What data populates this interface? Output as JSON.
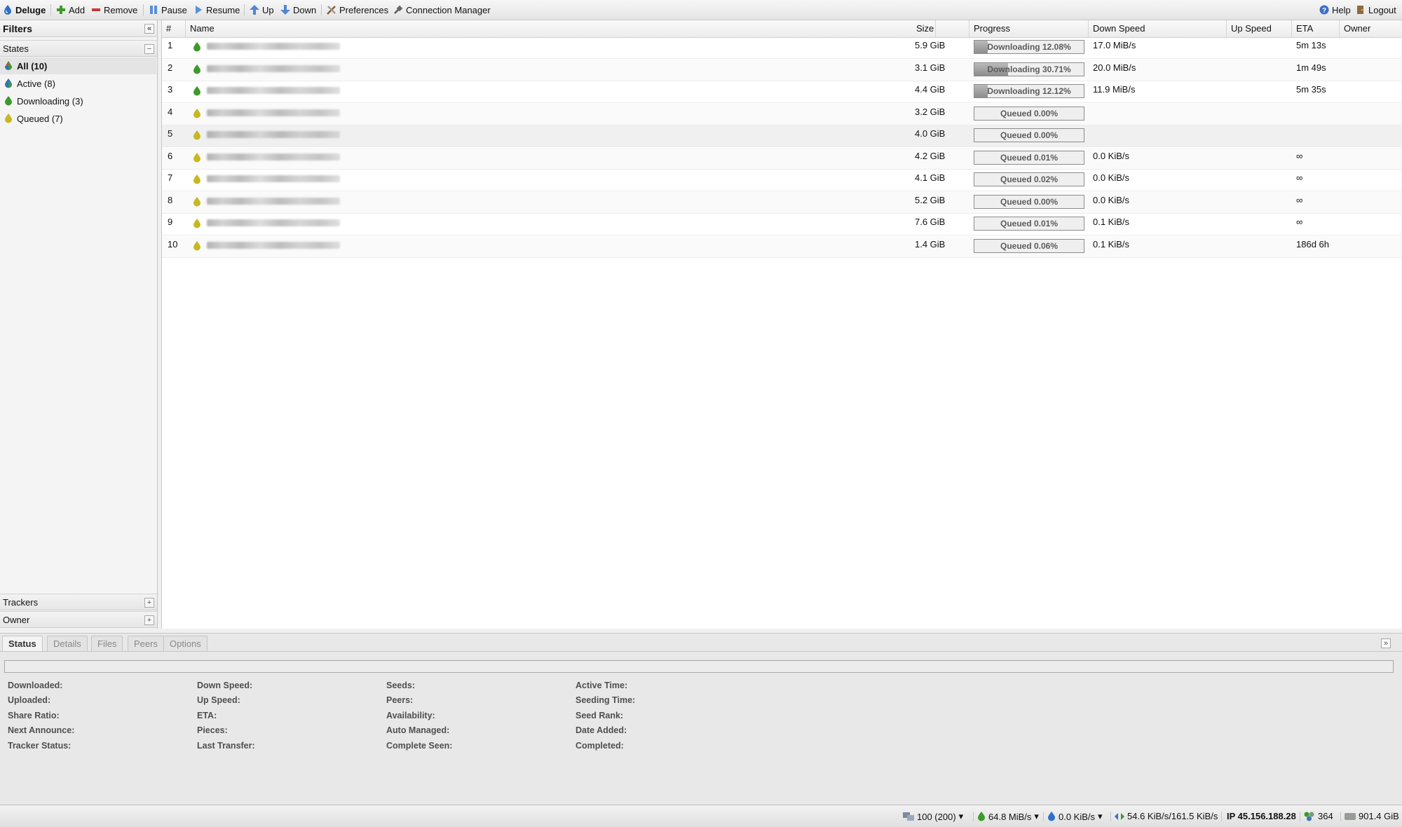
{
  "toolbar": {
    "app_name": "Deluge",
    "add": "Add",
    "remove": "Remove",
    "pause": "Pause",
    "resume": "Resume",
    "up": "Up",
    "down": "Down",
    "preferences": "Preferences",
    "connection_manager": "Connection Manager",
    "help": "Help",
    "logout": "Logout"
  },
  "sidebar": {
    "title": "Filters",
    "states_title": "States",
    "states": [
      {
        "label": "All (10)",
        "selected": true,
        "icon": "all-states-icon"
      },
      {
        "label": "Active (8)",
        "selected": false,
        "icon": "active-state-icon"
      },
      {
        "label": "Downloading (3)",
        "selected": false,
        "icon": "downloading-state-icon"
      },
      {
        "label": "Queued (7)",
        "selected": false,
        "icon": "queued-state-icon"
      }
    ],
    "trackers_title": "Trackers",
    "owner_title": "Owner"
  },
  "grid": {
    "columns": [
      "#",
      "Name",
      "Size",
      "Progress",
      "Down Speed",
      "Up Speed",
      "ETA",
      "Owner"
    ],
    "rows": [
      {
        "num": "1",
        "size": "5.9 GiB",
        "progress_text": "Downloading 12.08%",
        "progress": 0.1208,
        "state": "downloading",
        "down_speed": "17.0 MiB/s",
        "up_speed": "",
        "eta": "5m 13s"
      },
      {
        "num": "2",
        "size": "3.1 GiB",
        "progress_text": "Downloading 30.71%",
        "progress": 0.3071,
        "state": "downloading",
        "down_speed": "20.0 MiB/s",
        "up_speed": "",
        "eta": "1m 49s"
      },
      {
        "num": "3",
        "size": "4.4 GiB",
        "progress_text": "Downloading 12.12%",
        "progress": 0.1212,
        "state": "downloading",
        "down_speed": "11.9 MiB/s",
        "up_speed": "",
        "eta": "5m 35s"
      },
      {
        "num": "4",
        "size": "3.2 GiB",
        "progress_text": "Queued 0.00%",
        "progress": 0.0,
        "state": "queued",
        "down_speed": "",
        "up_speed": "",
        "eta": ""
      },
      {
        "num": "5",
        "size": "4.0 GiB",
        "progress_text": "Queued 0.00%",
        "progress": 0.0,
        "state": "queued",
        "down_speed": "",
        "up_speed": "",
        "eta": ""
      },
      {
        "num": "6",
        "size": "4.2 GiB",
        "progress_text": "Queued 0.01%",
        "progress": 0.0001,
        "state": "queued",
        "down_speed": "0.0 KiB/s",
        "up_speed": "",
        "eta": "∞"
      },
      {
        "num": "7",
        "size": "4.1 GiB",
        "progress_text": "Queued 0.02%",
        "progress": 0.0002,
        "state": "queued",
        "down_speed": "0.0 KiB/s",
        "up_speed": "",
        "eta": "∞"
      },
      {
        "num": "8",
        "size": "5.2 GiB",
        "progress_text": "Queued 0.00%",
        "progress": 0.0,
        "state": "queued",
        "down_speed": "0.0 KiB/s",
        "up_speed": "",
        "eta": "∞"
      },
      {
        "num": "9",
        "size": "7.6 GiB",
        "progress_text": "Queued 0.01%",
        "progress": 0.0001,
        "state": "queued",
        "down_speed": "0.1 KiB/s",
        "up_speed": "",
        "eta": "∞"
      },
      {
        "num": "10",
        "size": "1.4 GiB",
        "progress_text": "Queued 0.06%",
        "progress": 0.0006,
        "state": "queued",
        "down_speed": "0.1 KiB/s",
        "up_speed": "",
        "eta": "186d 6h"
      }
    ]
  },
  "details": {
    "tabs": [
      "Status",
      "Details",
      "Files",
      "Peers",
      "Options"
    ],
    "active_tab": "Status",
    "fields": [
      [
        "Downloaded:",
        "Uploaded:",
        "Share Ratio:",
        "Next Announce:",
        "Tracker Status:"
      ],
      [
        "Down Speed:",
        "Up Speed:",
        "ETA:",
        "Pieces:",
        "Last Transfer:"
      ],
      [
        "Seeds:",
        "Peers:",
        "Availability:",
        "Auto Managed:",
        "Complete Seen:"
      ],
      [
        "Active Time:",
        "Seeding Time:",
        "Seed Rank:",
        "Date Added:",
        "Completed:"
      ]
    ]
  },
  "statusbar": {
    "connections": "100 (200)",
    "download_speed": "64.8 MiB/s",
    "upload_speed": "0.0 KiB/s",
    "protocol_traffic": "54.6 KiB/s/161.5 KiB/s",
    "ip": "IP 45.156.188.28",
    "dht_nodes": "364",
    "free_space": "901.4 GiB"
  },
  "colors": {
    "accent_green": "#3c9a2a",
    "queued_yellow": "#c8b820",
    "deluge_blue": "#2f6fc7"
  }
}
